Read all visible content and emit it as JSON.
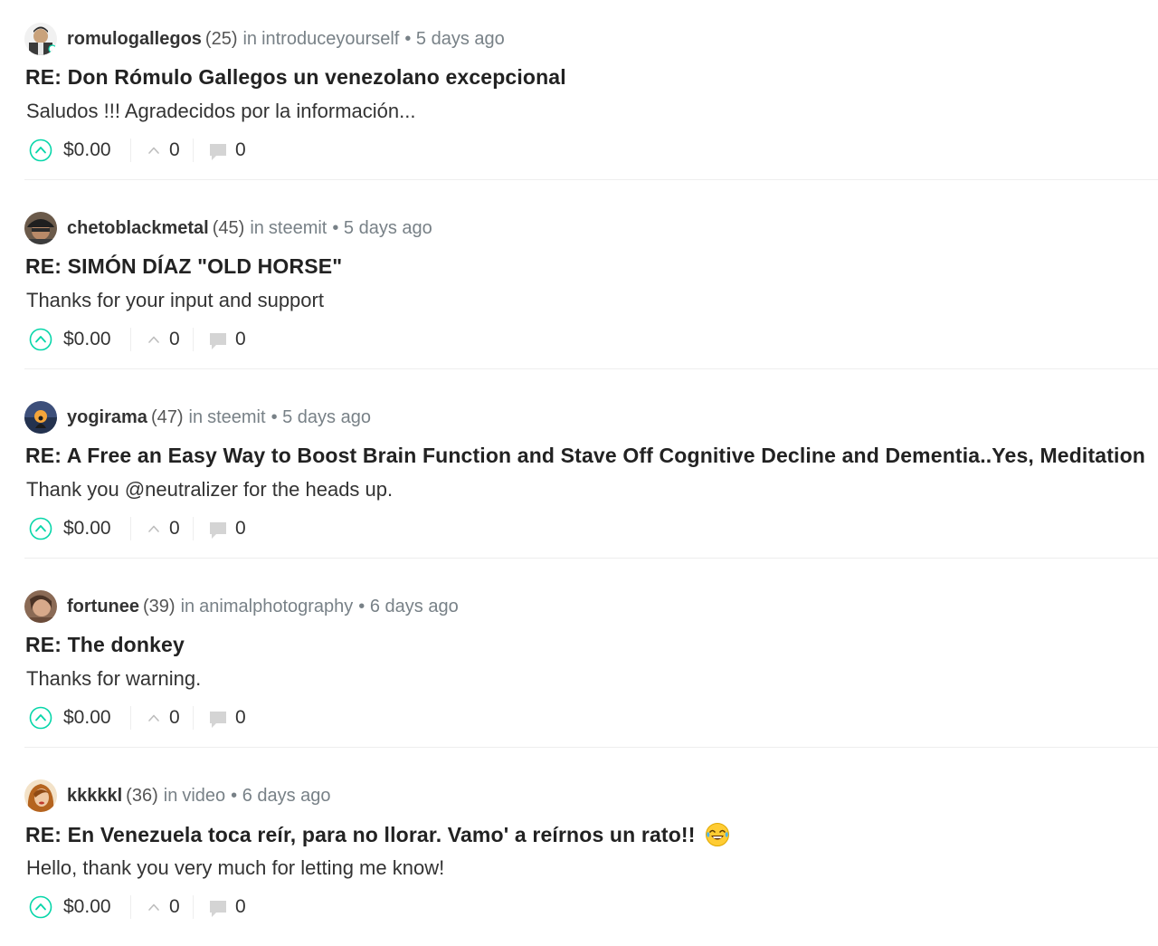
{
  "colors": {
    "accent": "#4ba2f2",
    "upvote": "#06d6a9",
    "text": "#333333",
    "muted": "#788187",
    "divider": "#eeeeee"
  },
  "posts": [
    {
      "author": "romulogallegos",
      "reputation": "(25)",
      "in_label": "in",
      "community": "introduceyourself",
      "time": "• 5 days ago",
      "title": "RE: Don Rómulo Gallegos un venezolano excepcional",
      "body": "Saludos !!! Agradecidos por la información...",
      "payout": "$0.00",
      "votes": "0",
      "replies": "0",
      "avatar_icon": "person-portrait-icon"
    },
    {
      "author": "chetoblackmetal",
      "reputation": "(45)",
      "in_label": "in",
      "community": "steemit",
      "time": "• 5 days ago",
      "title": "RE: SIMÓN DÍAZ \"OLD HORSE\"",
      "body": "Thanks for your input and support",
      "payout": "$0.00",
      "votes": "0",
      "replies": "0",
      "avatar_icon": "person-cap-icon"
    },
    {
      "author": "yogirama",
      "reputation": "(47)",
      "in_label": "in",
      "community": "steemit",
      "time": "• 5 days ago",
      "title": "RE: A Free an Easy Way to Boost Brain Function and Stave Off Cognitive Decline and Dementia..Yes, Meditation",
      "body": "Thank you @neutralizer for the heads up.",
      "payout": "$0.00",
      "votes": "0",
      "replies": "0",
      "avatar_icon": "meditation-sunset-icon"
    },
    {
      "author": "fortunee",
      "reputation": "(39)",
      "in_label": "in",
      "community": "animalphotography",
      "time": "• 6 days ago",
      "title": "RE: The donkey",
      "body": "Thanks for warning.",
      "payout": "$0.00",
      "votes": "0",
      "replies": "0",
      "avatar_icon": "person-face-icon"
    },
    {
      "author": "kkkkkl",
      "reputation": "(36)",
      "in_label": "in",
      "community": "video",
      "time": "• 6 days ago",
      "title": "RE: En Venezuela toca reír, para no llorar. Vamo' a reírnos un rato!!",
      "body": "Hello, thank you very much for letting me know!",
      "payout": "$0.00",
      "votes": "0",
      "replies": "0",
      "avatar_icon": "woman-face-icon",
      "title_emoji": "laughing-tears-emoji"
    }
  ]
}
